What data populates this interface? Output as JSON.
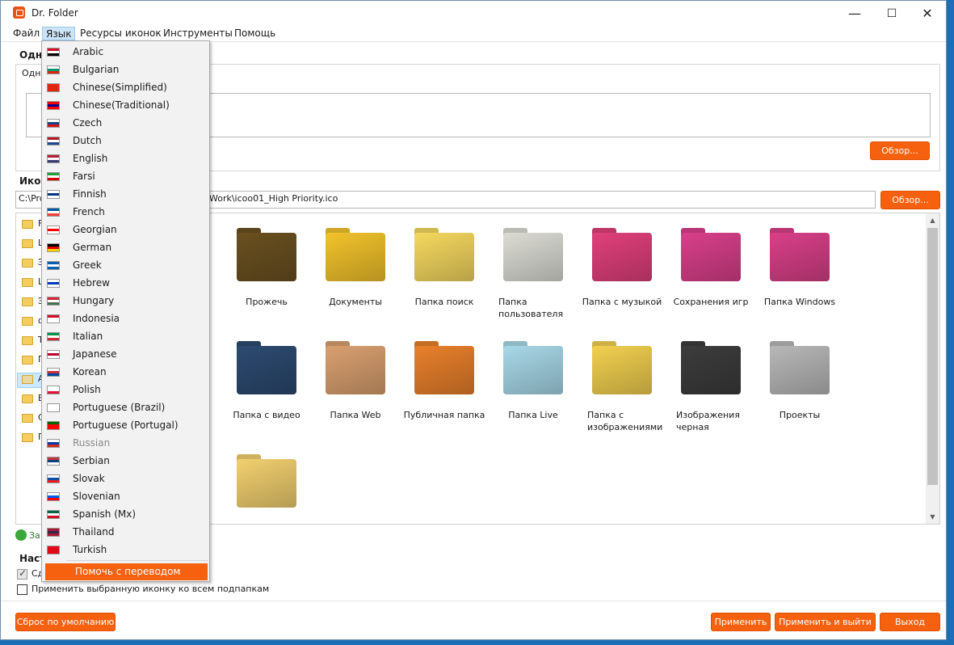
{
  "window": {
    "title": "Dr. Folder",
    "minimize": "—",
    "maximize": "☐",
    "close": "✕"
  },
  "menubar": {
    "items": [
      "Файл",
      "Язык",
      "Ресурсы иконок",
      "Инструменты",
      "Помощь"
    ]
  },
  "content": {
    "section1_label": "Одна",
    "section1_sublabel": "Одна",
    "browse1": "Обзор...",
    "icon_label": "Икон",
    "icon_path": "C:\\Pro",
    "icon_path_tail": "Work\\icoo01_High Priority.ico",
    "browse2": "Обзор...",
    "tree_letters": [
      "F",
      "L",
      "Э",
      "L",
      "Э",
      "ф",
      "T",
      "П",
      "A",
      "B",
      "C",
      "П"
    ],
    "add_label": "За",
    "settings_label": "Настр",
    "check1_label": "Сд",
    "check2_label": "Применить выбранную иконку ко всем подпапкам"
  },
  "icons": [
    {
      "label": "Прожечь",
      "color": "#6a5020"
    },
    {
      "label": "Документы",
      "color": "#f2c32c"
    },
    {
      "label": "Папка поиск",
      "color": "#f5d860"
    },
    {
      "label": "Папка пользователя",
      "color": "#dcdcd5"
    },
    {
      "label": "Папка с музыкой",
      "color": "#e0407a"
    },
    {
      "label": "Сохранения игр",
      "color": "#d8408a"
    },
    {
      "label": "Папка Windows",
      "color": "#d84088"
    },
    {
      "label": "Папка с видео",
      "color": "#2c4a70"
    },
    {
      "label": "Папка Web",
      "color": "#d9a070"
    },
    {
      "label": "Публичная папка",
      "color": "#e8802c"
    },
    {
      "label": "Папка Live",
      "color": "#a8d8e8"
    },
    {
      "label": "Папка с изображениями",
      "color": "#f2d050"
    },
    {
      "label": "Изображения черная",
      "color": "#3c3c3c"
    },
    {
      "label": "Проекты",
      "color": "#b8b8b8"
    },
    {
      "label": "",
      "color": "#f2d070"
    }
  ],
  "buttons": {
    "reset": "Сброс по умолчанию",
    "apply": "Применить",
    "apply_exit": "Применить и выйти",
    "exit": "Выход"
  },
  "language_menu": {
    "languages": [
      {
        "name": "Arabic",
        "flag": [
          "#ce1126",
          "#ffffff",
          "#000000"
        ]
      },
      {
        "name": "Bulgarian",
        "flag": [
          "#ffffff",
          "#00966e",
          "#d62612"
        ]
      },
      {
        "name": "Chinese(Simplified)",
        "flag": [
          "#de2910",
          "#de2910",
          "#de2910"
        ]
      },
      {
        "name": "Chinese(Traditional)",
        "flag": [
          "#fe0000",
          "#000095",
          "#fe0000"
        ]
      },
      {
        "name": "Czech",
        "flag": [
          "#ffffff",
          "#11457e",
          "#d7141a"
        ]
      },
      {
        "name": "Dutch",
        "flag": [
          "#ae1c28",
          "#ffffff",
          "#21468b"
        ]
      },
      {
        "name": "English",
        "flag": [
          "#b22234",
          "#ffffff",
          "#3c3b6e"
        ]
      },
      {
        "name": "Farsi",
        "flag": [
          "#239f40",
          "#ffffff",
          "#da0000"
        ]
      },
      {
        "name": "Finnish",
        "flag": [
          "#ffffff",
          "#003580",
          "#ffffff"
        ]
      },
      {
        "name": "French",
        "flag": [
          "#0055a4",
          "#ffffff",
          "#ef4135"
        ]
      },
      {
        "name": "Georgian",
        "flag": [
          "#ffffff",
          "#ff0000",
          "#ffffff"
        ]
      },
      {
        "name": "German",
        "flag": [
          "#000000",
          "#dd0000",
          "#ffce00"
        ]
      },
      {
        "name": "Greek",
        "flag": [
          "#0d5eaf",
          "#ffffff",
          "#0d5eaf"
        ]
      },
      {
        "name": "Hebrew",
        "flag": [
          "#ffffff",
          "#0038b8",
          "#ffffff"
        ]
      },
      {
        "name": "Hungary",
        "flag": [
          "#ce2939",
          "#ffffff",
          "#477050"
        ]
      },
      {
        "name": "Indonesia",
        "flag": [
          "#ce1126",
          "#ffffff",
          "#ffffff"
        ]
      },
      {
        "name": "Italian",
        "flag": [
          "#009246",
          "#ffffff",
          "#ce2b37"
        ]
      },
      {
        "name": "Japanese",
        "flag": [
          "#ffffff",
          "#bc002d",
          "#ffffff"
        ]
      },
      {
        "name": "Korean",
        "flag": [
          "#ffffff",
          "#cd2e3a",
          "#0047a0"
        ]
      },
      {
        "name": "Polish",
        "flag": [
          "#ffffff",
          "#ffffff",
          "#dc143c"
        ]
      },
      {
        "name": "Portuguese (Brazil)",
        "flag": [
          "#ffffff",
          "#ffffff",
          "#ffffff"
        ]
      },
      {
        "name": "Portuguese (Portugal)",
        "flag": [
          "#006600",
          "#ff0000",
          "#ff0000"
        ]
      },
      {
        "name": "Russian",
        "flag": [
          "#ffffff",
          "#0039a6",
          "#d52b1e"
        ],
        "disabled": true
      },
      {
        "name": "Serbian",
        "flag": [
          "#c6363c",
          "#0c4076",
          "#ffffff"
        ]
      },
      {
        "name": "Slovak",
        "flag": [
          "#ffffff",
          "#0b4ea2",
          "#ee1c25"
        ]
      },
      {
        "name": "Slovenian",
        "flag": [
          "#ffffff",
          "#005ce5",
          "#ff0000"
        ]
      },
      {
        "name": "Spanish (Mx)",
        "flag": [
          "#006847",
          "#ffffff",
          "#ce1126"
        ]
      },
      {
        "name": "Thailand",
        "flag": [
          "#a51931",
          "#2d2a4a",
          "#a51931"
        ]
      },
      {
        "name": "Turkish",
        "flag": [
          "#e30a17",
          "#e30a17",
          "#e30a17"
        ]
      }
    ],
    "help_translate": "Помочь с переводом"
  },
  "colors": {
    "accent": "#f5610f",
    "menu_active": "#cce4f7",
    "desktop": "#1d6fb5"
  }
}
